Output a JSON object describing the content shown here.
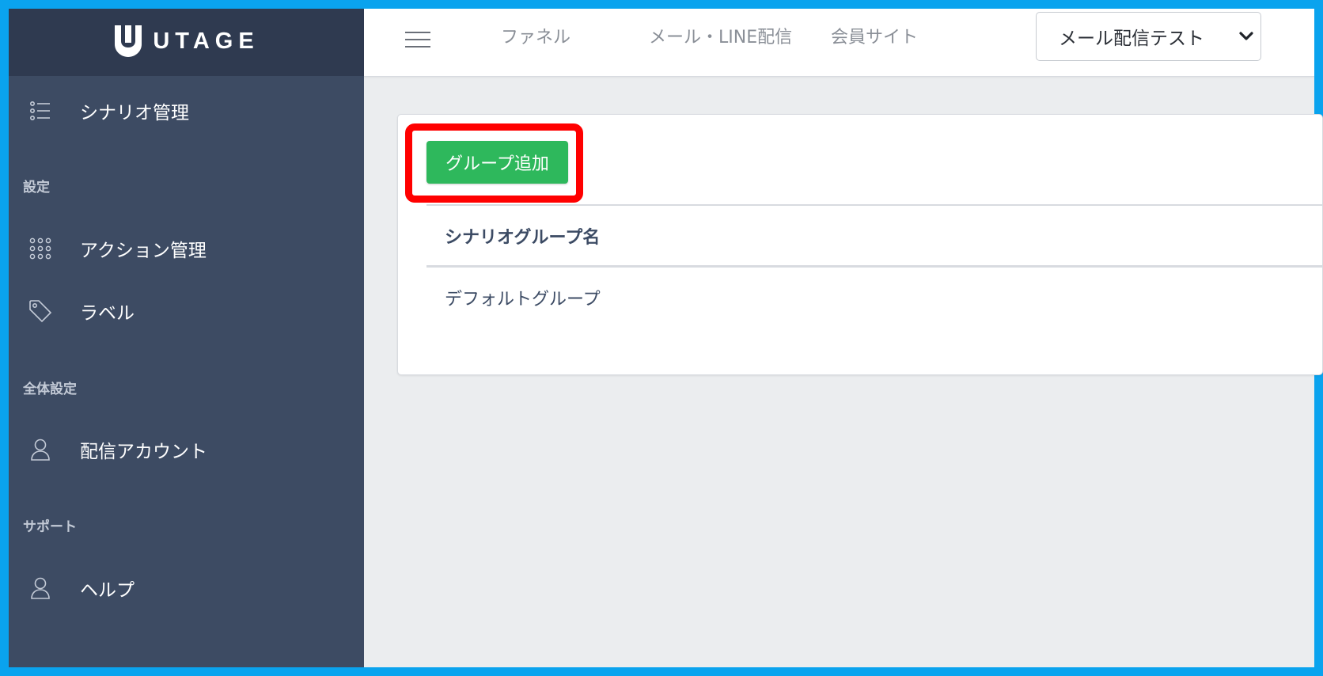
{
  "brand": {
    "name": "UTAGE",
    "logo_icon": "utage-logo-icon"
  },
  "sidebar": {
    "items": [
      {
        "label": "シナリオ管理",
        "icon": "list-icon"
      },
      {
        "label": "アクション管理",
        "icon": "grid-dots-icon"
      },
      {
        "label": "ラベル",
        "icon": "tag-icon"
      },
      {
        "label": "配信アカウント",
        "icon": "user-icon"
      },
      {
        "label": "ヘルプ",
        "icon": "user-icon"
      }
    ],
    "sections": [
      "設定",
      "全体設定",
      "サポート"
    ]
  },
  "header": {
    "menu_icon": "hamburger-icon",
    "links": [
      "ファネル",
      "メール・LINE配信",
      "会員サイト"
    ],
    "account_select": {
      "value": "メール配信テスト",
      "icon": "chevron-down-icon"
    }
  },
  "main": {
    "add_group_button": "グループ追加",
    "table": {
      "header": "シナリオグループ名",
      "rows": [
        "デフォルトグループ"
      ]
    }
  },
  "colors": {
    "sidebar_bg": "#3d4b63",
    "brand_bg": "#2f3a50",
    "button_green": "#2eb85c",
    "highlight_red": "#ff0000",
    "frame_blue": "#0aa3ee"
  }
}
